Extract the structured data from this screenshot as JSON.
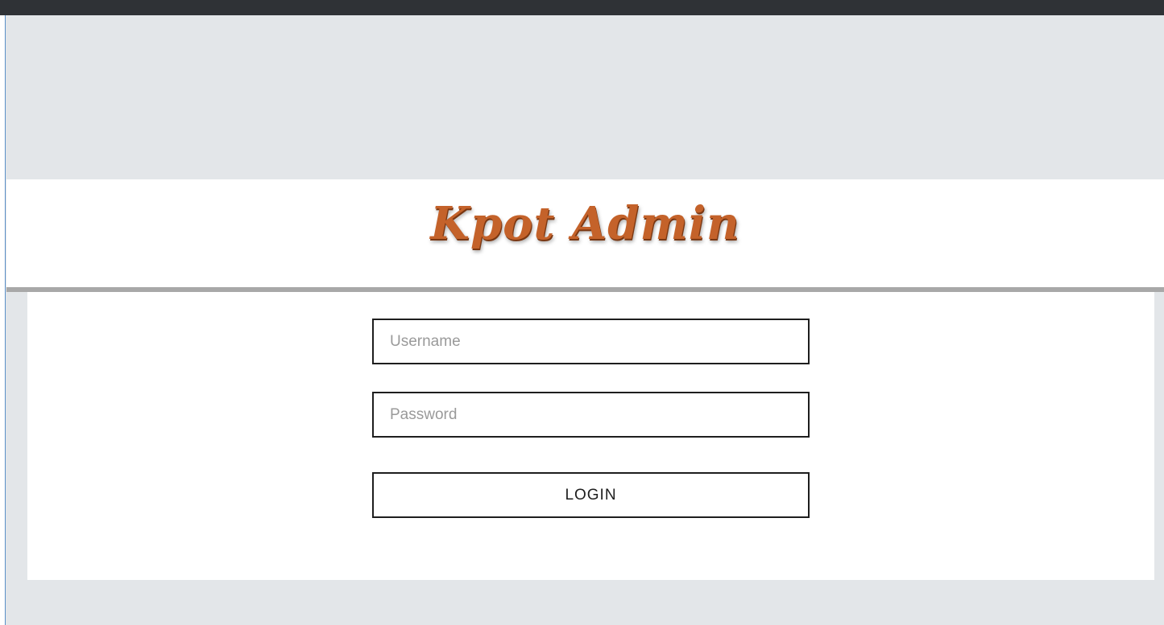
{
  "logo": {
    "text": "Kpot Admin",
    "color": "#c4622a"
  },
  "form": {
    "username_placeholder": "Username",
    "username_value": "",
    "password_placeholder": "Password",
    "password_value": "",
    "login_label": "LOGIN"
  }
}
